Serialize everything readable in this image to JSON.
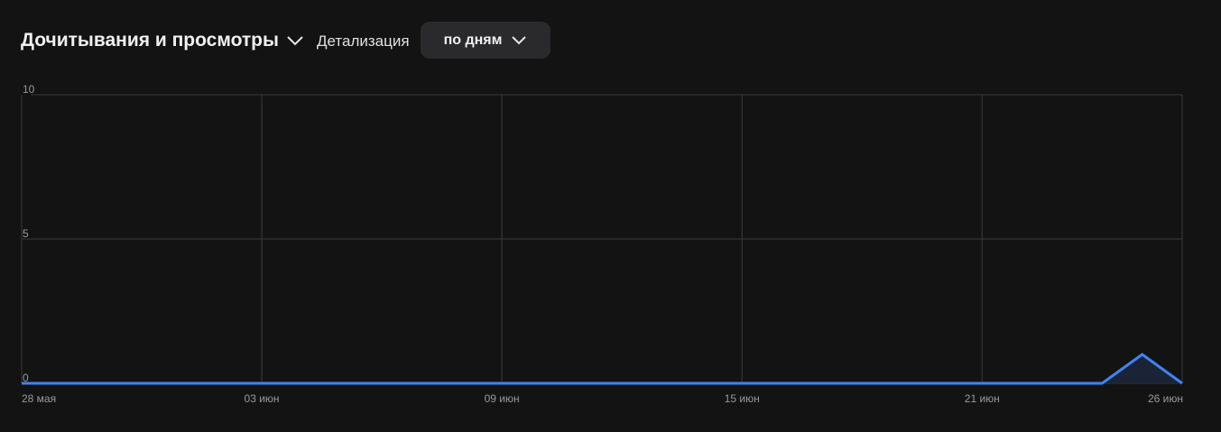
{
  "header": {
    "title": "Дочитывания и просмотры",
    "detail_label": "Детализация",
    "detail_value": "по дням"
  },
  "chart_data": {
    "type": "area",
    "title": "Дочитывания и просмотры",
    "xlabel": "",
    "ylabel": "",
    "ylim": [
      0,
      10
    ],
    "yticks": [
      "0",
      "5",
      "10"
    ],
    "x_ticks": [
      {
        "day": 0,
        "label": "28 мая"
      },
      {
        "day": 6,
        "label": "03 июн"
      },
      {
        "day": 12,
        "label": "09 июн"
      },
      {
        "day": 18,
        "label": "15 июн"
      },
      {
        "day": 24,
        "label": "21 июн"
      },
      {
        "day": 29,
        "label": "26 июн"
      }
    ],
    "x_range_days": [
      0,
      29
    ],
    "values": [
      0,
      0,
      0,
      0,
      0,
      0,
      0,
      0,
      0,
      0,
      0,
      0,
      0,
      0,
      0,
      0,
      0,
      0,
      0,
      0,
      0,
      0,
      0,
      0,
      0,
      0,
      0,
      0,
      1,
      0
    ],
    "grid": true,
    "line_color": "#3d84f5",
    "fill_color": "#1b2436"
  }
}
